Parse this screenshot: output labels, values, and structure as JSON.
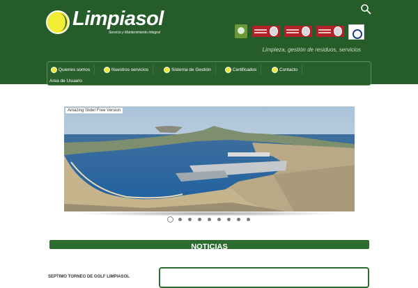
{
  "header": {
    "logo_text": "Limpiasol",
    "logo_tagline": "Servicio y Mantenimiento Integral",
    "tagline": "Limpieza, gestión de residuos, servicios",
    "background": "#265b2a"
  },
  "nav": {
    "items": [
      {
        "label": "Quienes somos"
      },
      {
        "label": "Nuestros servicios"
      },
      {
        "label": "Sistema de Gestión"
      },
      {
        "label": "Certificados"
      },
      {
        "label": "Contacto"
      },
      {
        "label": "Area de Usuario"
      }
    ],
    "icon": "yellow-ball-icon"
  },
  "slider": {
    "label": "Amazing Slider Free Version",
    "image": "coastal-bay-aerial-photo",
    "slide_count": 9,
    "active_slide": 1
  },
  "news": {
    "heading": "NOTICIAS",
    "first_title": "SEPTIMO TORNEO DE GOLF LIMPIASOL",
    "accent": "#2c6c2e"
  }
}
